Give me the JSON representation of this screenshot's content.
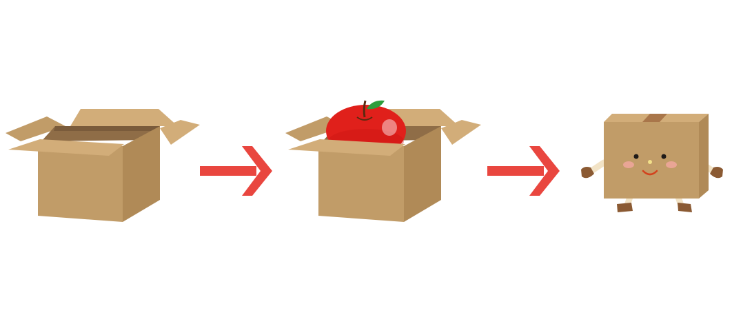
{
  "scene": {
    "background": "#ffffff",
    "sequence": [
      "open-cardboard-box",
      "arrow",
      "open-box-with-apple",
      "arrow",
      "box-character"
    ]
  },
  "colors": {
    "cardboard_light": "#d2ad79",
    "cardboard_mid": "#c19c68",
    "cardboard_dark": "#b08a57",
    "cardboard_inner": "#8f6d47",
    "cardboard_inner_dark": "#7a5b3b",
    "apple_red": "#e0201b",
    "apple_dark": "#c51512",
    "leaf_green": "#2e9d3c",
    "stem_brown": "#5a2a10",
    "arrow_red": "#e9463f",
    "tape_brown": "#a9764a",
    "limb_light": "#f2e3c6",
    "limb_brown": "#8b5a33",
    "eye": "#1e1a18",
    "nose": "#f2e08a",
    "cheek": "#f2a7a0",
    "mouth": "#d2421d"
  },
  "icons": {
    "box_open": "cardboard-box-open-icon",
    "apple": "red-apple-icon",
    "arrow": "right-arrow-icon",
    "character": "cardboard-box-character-icon"
  }
}
